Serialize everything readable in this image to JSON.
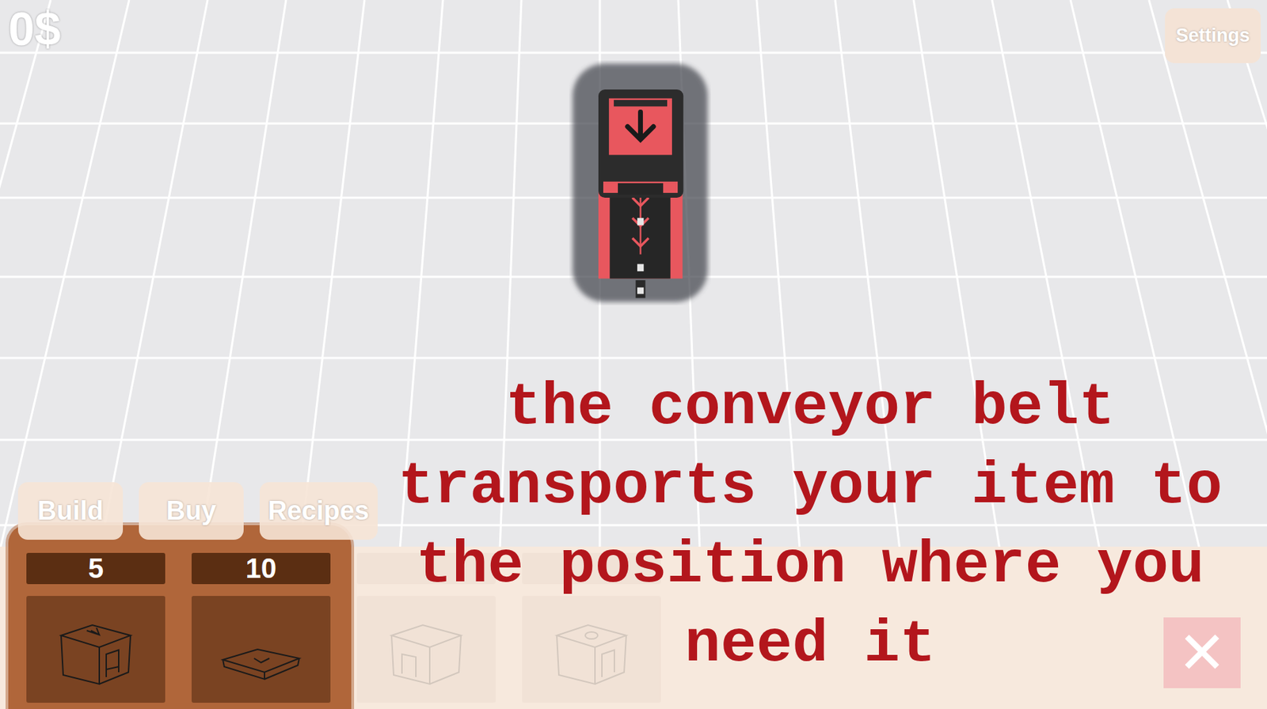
{
  "hud": {
    "money": "0$",
    "settings_button": "Settings"
  },
  "tabs": [
    {
      "label": "Build",
      "selected": false
    },
    {
      "label": "Buy",
      "selected": false
    },
    {
      "label": "Recipes",
      "selected": false
    }
  ],
  "shop_items": [
    {
      "kind": "spawner",
      "price": "5",
      "disabled": false
    },
    {
      "kind": "belt",
      "price": "10",
      "disabled": false
    },
    {
      "kind": "crafter",
      "disabled": true
    },
    {
      "kind": "seller",
      "disabled": true
    }
  ],
  "tutorial": {
    "text": "the conveyor belt transports your item to the position where you need it"
  },
  "close_button": "✕"
}
